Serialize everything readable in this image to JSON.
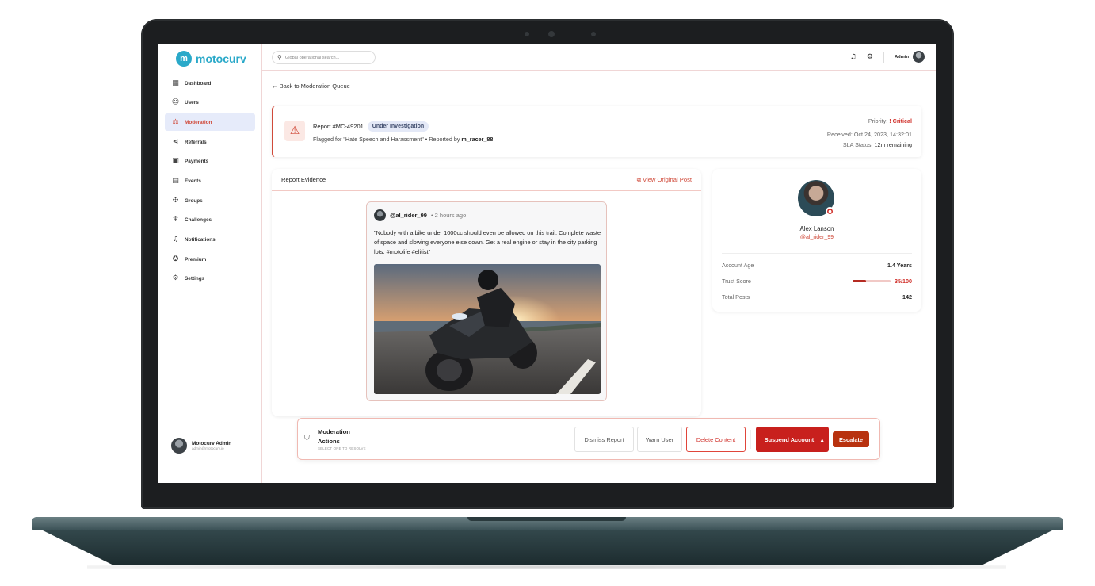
{
  "app": {
    "logo_mark": "m",
    "name": "motocurv"
  },
  "search": {
    "placeholder": "Global operational search..."
  },
  "topbar": {
    "admin_label": "Admin",
    "icons": [
      "bell-icon",
      "settings-icon"
    ]
  },
  "sidebar": {
    "items": [
      {
        "label": "Dashboard",
        "icon": "▦",
        "icon_name": "dashboard-icon"
      },
      {
        "label": "Users",
        "icon": "☺",
        "icon_name": "users-icon"
      },
      {
        "label": "Moderation",
        "icon": "⚖",
        "icon_name": "gavel-icon",
        "active": true
      },
      {
        "label": "Referrals",
        "icon": "⋖",
        "icon_name": "share-icon"
      },
      {
        "label": "Payments",
        "icon": "▣",
        "icon_name": "payments-icon"
      },
      {
        "label": "Events",
        "icon": "▤",
        "icon_name": "calendar-icon"
      },
      {
        "label": "Groups",
        "icon": "✣",
        "icon_name": "groups-icon"
      },
      {
        "label": "Challenges",
        "icon": "♆",
        "icon_name": "trophy-icon"
      },
      {
        "label": "Notifications",
        "icon": "♫",
        "icon_name": "bell-icon"
      },
      {
        "label": "Premium",
        "icon": "✪",
        "icon_name": "premium-icon"
      },
      {
        "label": "Settings",
        "icon": "⚙",
        "icon_name": "settings-icon"
      }
    ],
    "user": {
      "name": "Motocurv Admin",
      "email": "admin@motocurv.io"
    }
  },
  "back_link": "← Back to Moderation Queue",
  "report": {
    "title": "Report #MC-49201",
    "status": "Under Investigation",
    "flag_prefix": "Flagged for \"Hate Speech and Harassment\" • Reported by",
    "reporter": "m_racer_88",
    "priority_label": "Priority:",
    "priority_value": "! Critical",
    "received": "Received: Oct 24, 2023, 14:32:01",
    "sla_label": "SLA Status:",
    "sla_value": "12m remaining"
  },
  "evidence": {
    "title": "Report Evidence",
    "view_link": "⧉ View Original Post",
    "post_user": "@al_rider_99",
    "post_time": "• 2 hours ago",
    "post_text": "\"Nobody with a bike under 1000cc should even be allowed on this trail. Complete waste of space and slowing everyone else down. Get a real engine or stay in the city parking lots. #motolife #elitist\""
  },
  "profile": {
    "name": "Alex Lanson",
    "handle": "@al_rider_99",
    "rows": [
      {
        "label": "Account Age",
        "value": "1.4 Years"
      },
      {
        "label": "Trust Score",
        "value": "35/100"
      },
      {
        "label": "Total Posts",
        "value": "142"
      }
    ],
    "trust_fraction": 0.35
  },
  "actions": {
    "title": "Moderation Actions",
    "hint": "SELECT ONE TO RESOLVE",
    "dismiss": "Dismiss Report",
    "warn": "Warn User",
    "delete": "Delete Content",
    "suspend": "Suspend Account",
    "escalate": "Escalate"
  },
  "colors": {
    "accent": "#d04a3a",
    "brand": "#2aa9c9",
    "critical": "#d0302a"
  }
}
